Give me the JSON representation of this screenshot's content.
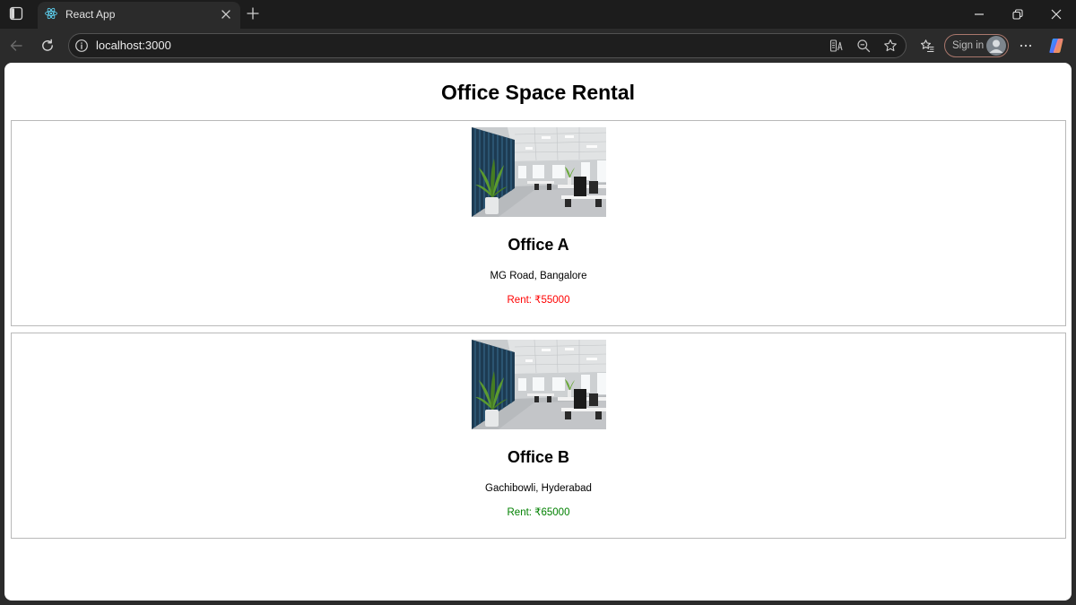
{
  "browser": {
    "tab": {
      "title": "React App",
      "icon": "react-logo-icon"
    },
    "address_bar": {
      "url": "localhost:3000"
    },
    "profile": {
      "label": "Sign in"
    },
    "icons": {
      "tab_actions": "tab-actions-icon",
      "close_tab": "close-tab-icon",
      "new_tab": "plus-icon",
      "back": "back-arrow-icon",
      "refresh": "refresh-icon",
      "site_info": "info-icon",
      "reader": "immersive-reader-icon",
      "zoom": "zoom-out-icon",
      "add_favorite": "star-icon",
      "favorites": "favorites-icon",
      "more": "more-icon",
      "copilot": "copilot-icon"
    }
  },
  "page": {
    "title": "Office Space Rental",
    "offices": [
      {
        "name": "Office A",
        "address": "MG Road, Bangalore",
        "rent": "Rent: ₹55000",
        "rent_color": "#ff0000"
      },
      {
        "name": "Office B",
        "address": "Gachibowli, Hyderabad",
        "rent": "Rent: ₹65000",
        "rent_color": "#008000"
      }
    ]
  }
}
